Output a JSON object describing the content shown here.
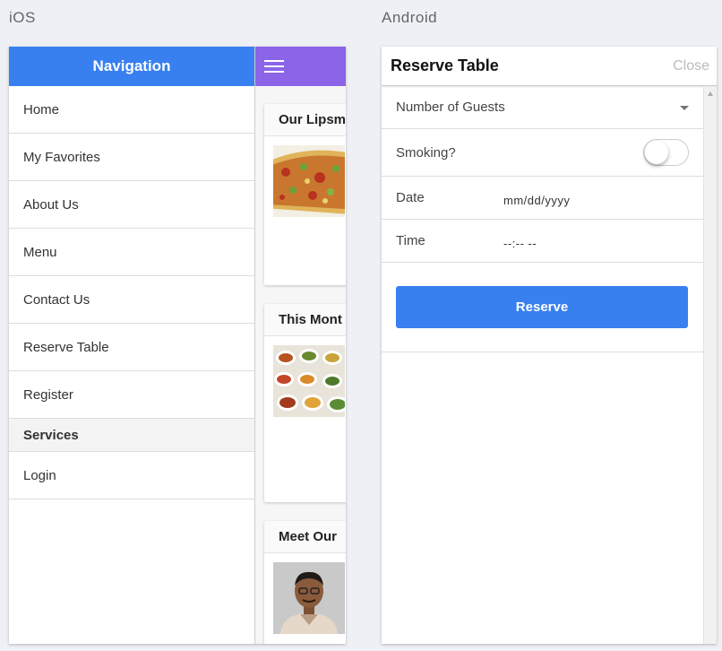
{
  "labels": {
    "ios": "iOS",
    "android": "Android"
  },
  "ios": {
    "menu_title": "Navigation",
    "menu_items": [
      "Home",
      "My Favorites",
      "About Us",
      "Menu",
      "Contact Us",
      "Reserve Table",
      "Register"
    ],
    "section_divider": "Services",
    "section_items": [
      "Login"
    ],
    "toolbar_icon": "menu-icon",
    "cards": [
      {
        "title": "Our Lipsm",
        "image": "pizza-image"
      },
      {
        "title": "This Mont",
        "image": "food-bowls-image"
      },
      {
        "title": "Meet Our",
        "image": "person-portrait-image"
      }
    ],
    "colors": {
      "menu_header": "#3880f0",
      "toolbar": "#8b64e8"
    }
  },
  "android": {
    "title": "Reserve Table",
    "close_label": "Close",
    "guests_label": "Number of Guests",
    "smoking_label": "Smoking?",
    "smoking_value": false,
    "date_label": "Date",
    "date_value": "mm/dd/yyyy",
    "time_label": "Time",
    "time_value": "--:-- --",
    "reserve_label": "Reserve",
    "colors": {
      "button": "#3880f0"
    }
  }
}
